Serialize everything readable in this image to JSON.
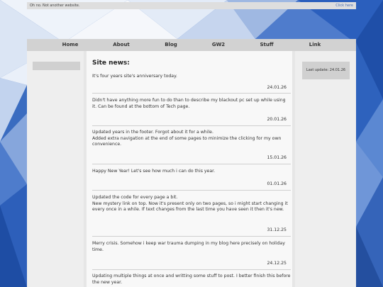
{
  "topbar": {
    "left_text": "Oh no. Not another website.",
    "right_link": "Click here"
  },
  "nav": {
    "items": [
      "Home",
      "About",
      "Blog",
      "GW2",
      "Stuff",
      "Link"
    ]
  },
  "main": {
    "heading": "Site news:"
  },
  "posts": [
    {
      "text": "It's four years site's anniversary today.",
      "date": "24.01.26"
    },
    {
      "text": "Didn't have anything more fun to do than to describe my blackout pc set up while using it. Can be found at the bottom of Tech page.",
      "date": "20.01.26"
    },
    {
      "text": "Updated years in the footer. Forgot about it for a while.\nAdded extra navigation at the end of some pages to minimize the clicking for my own convenience.",
      "date": "15.01.26"
    },
    {
      "text": "Happy New Year! Let's see how much i can do this year.",
      "date": "01.01.26"
    },
    {
      "text": "Updated the code for every page a bit.\nNew mystery link on top. Now it's present only on two pages, so i might start changing it every once in a while. If text changes from the last time you have seen it then it's new.",
      "date": "31.12.25"
    },
    {
      "text": "Merry crisis. Somehow i keep war trauma dumping in my blog here precisely on holiday time.",
      "date": "24.12.25"
    },
    {
      "text": "Updating multiple things at once and writting some stuff to post. I better finish this before the new year.",
      "date": ""
    }
  ],
  "sidebar": {
    "last_update": "Last update: 24.01.26"
  },
  "colors": {
    "background": "#2f64b8",
    "link": "#4a6fb5"
  }
}
